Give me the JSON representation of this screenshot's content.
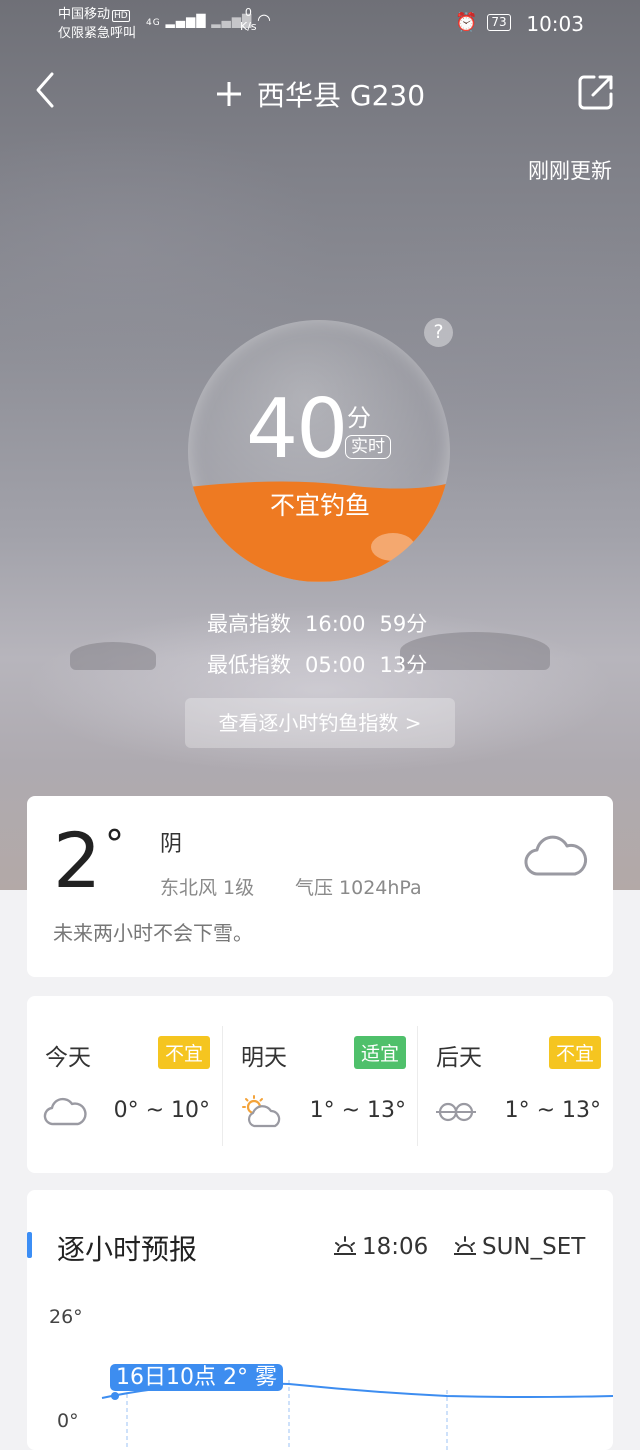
{
  "status_bar": {
    "carrier": "中国移动",
    "hd": "HD",
    "carrier_note": "仅限紧急呼叫",
    "signal": "4G",
    "speed_value": "0",
    "speed_unit": "K/s",
    "battery": "73",
    "time": "10:03"
  },
  "nav": {
    "title": "西华县 G230",
    "add_icon": "plus-icon",
    "back_icon": "chevron-left-icon",
    "share_icon": "share-icon"
  },
  "updated": "刚刚更新",
  "fishing_index": {
    "score": "40",
    "unit": "分",
    "realtime": "实时",
    "verdict": "不宜钓鱼",
    "level": 0.4,
    "fill_color": "#ee7a22",
    "highest_label": "最高指数",
    "highest_time": "16:00",
    "highest_score": "59分",
    "lowest_label": "最低指数",
    "lowest_time": "05:00",
    "lowest_score": "13分",
    "hourly_button": "查看逐小时钓鱼指数 >"
  },
  "current": {
    "temperature": "2",
    "degree": "°",
    "condition": "阴",
    "wind": "东北风 1级",
    "pressure": "气压 1024hPa",
    "note": "未来两小时不会下雪。",
    "icon": "cloud-icon"
  },
  "forecast": [
    {
      "day": "今天",
      "badge": "不宜",
      "badge_type": "warn",
      "range": "0° ~ 10°",
      "icon": "cloud-icon"
    },
    {
      "day": "明天",
      "badge": "适宜",
      "badge_type": "ok",
      "range": "1° ~ 13°",
      "icon": "sun-cloud-icon"
    },
    {
      "day": "后天",
      "badge": "不宜",
      "badge_type": "warn",
      "range": "1° ~ 13°",
      "icon": "fog-icon"
    }
  ],
  "hourly": {
    "title": "逐小时预报",
    "sunset_time": "18:06",
    "sunset_label": "SUN_SET",
    "y_max": "26°",
    "y_min": "0°",
    "tooltip": "16日10点 2° 雾",
    "accent": "#3d8df0"
  }
}
